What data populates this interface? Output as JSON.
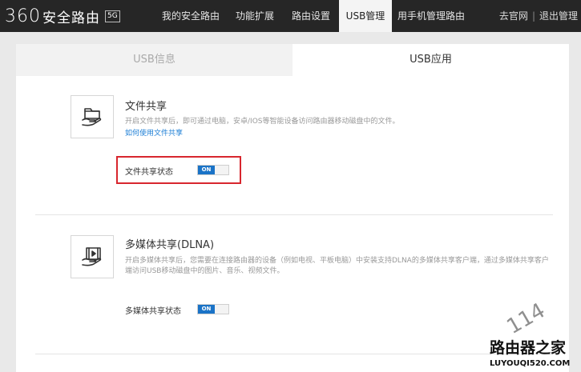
{
  "brand": {
    "number": "360",
    "name": "安全路由",
    "badge": "5G"
  },
  "nav": [
    {
      "label": "我的安全路由",
      "active": false
    },
    {
      "label": "功能扩展",
      "active": false
    },
    {
      "label": "路由设置",
      "active": false
    },
    {
      "label": "USB管理",
      "active": true
    },
    {
      "label": "用手机管理路由",
      "active": false
    }
  ],
  "top_links": {
    "official": "去官网",
    "separator": "|",
    "logout": "退出管理"
  },
  "subtabs": [
    {
      "label": "USB信息",
      "active": false
    },
    {
      "label": "USB应用",
      "active": true
    }
  ],
  "file_share": {
    "title": "文件共享",
    "description": "开启文件共享后，即可通过电脑，安卓/IOS等智能设备访问路由器移动磁盘中的文件。",
    "link": "如何使用文件共享",
    "status_label": "文件共享状态",
    "toggle": "ON",
    "icon": "folder-hand-icon"
  },
  "dlna": {
    "title": "多媒体共享(DLNA)",
    "description_line1": "开启多媒体共享后，您需要在连接路由器的设备（例如电视、平板电脑）中安装支持DLNA的多媒体共享客户端，通过多媒体共享客户",
    "description_line2": "端访问USB移动磁盘中的图片、音乐、视频文件。",
    "status_label": "多媒体共享状态",
    "toggle": "ON",
    "icon": "media-hand-icon"
  },
  "watermark": {
    "number": "114",
    "name": "路由器之家",
    "domain": "LUYOUQI520.COM"
  },
  "colors": {
    "topbar": "#262626",
    "accent": "#1a73c7",
    "highlight": "#d8262e"
  }
}
